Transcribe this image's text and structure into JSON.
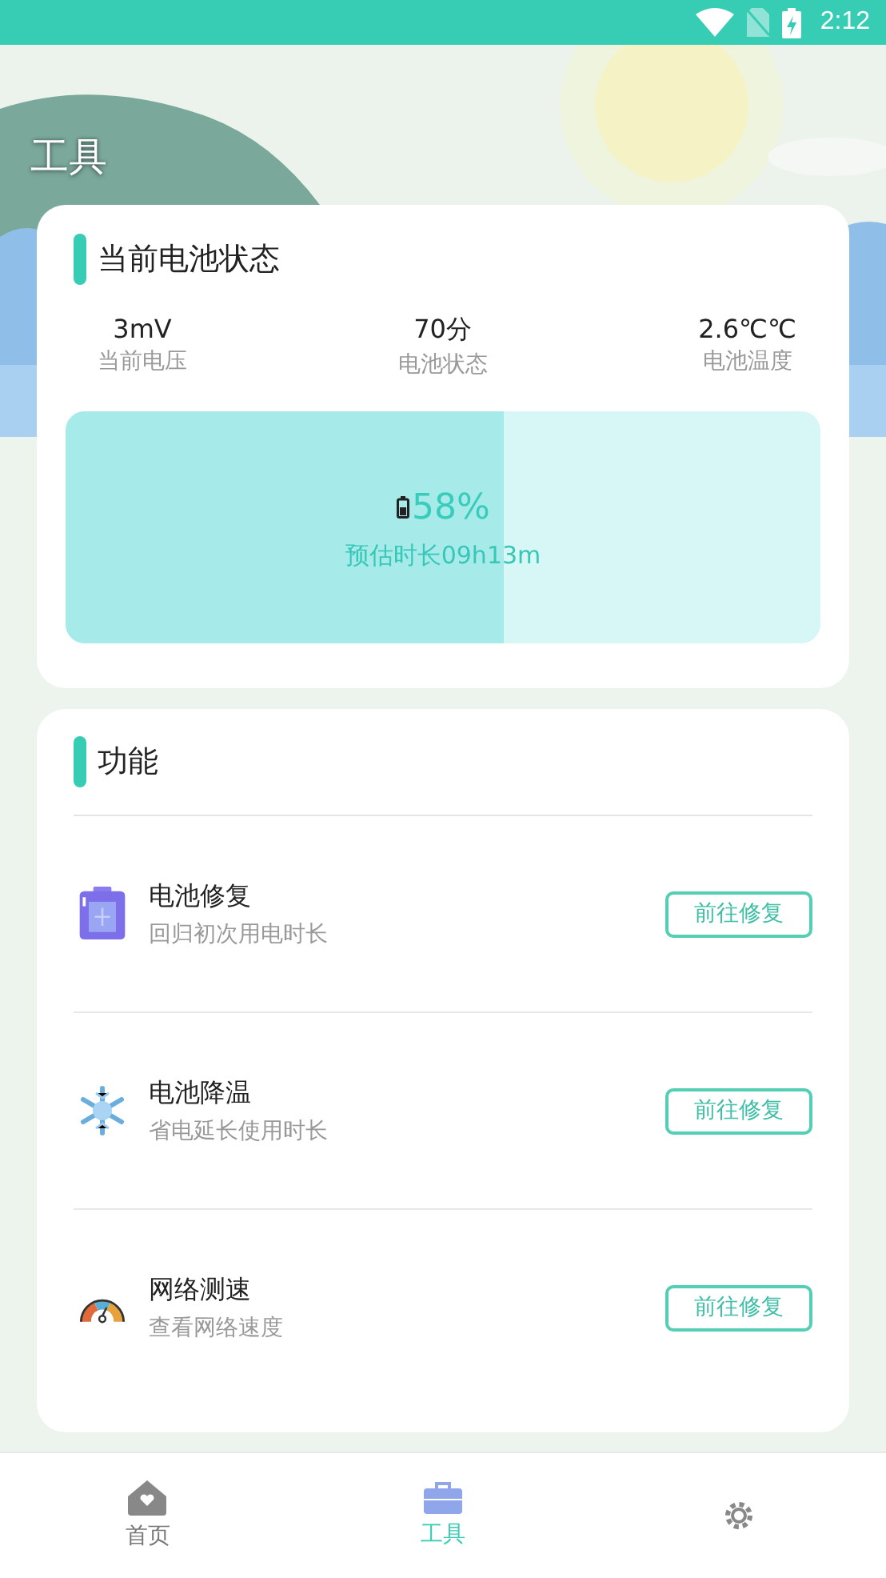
{
  "status_bar": {
    "time": "2:12"
  },
  "title": "工具",
  "battery_card": {
    "title": "当前电池状态",
    "stats": [
      {
        "value": "3mV",
        "label": "当前电压"
      },
      {
        "value": "70分",
        "label": "电池状态"
      },
      {
        "value": "2.6℃℃",
        "label": "电池温度"
      }
    ],
    "meter": {
      "level": 0.58,
      "percent": "58%",
      "estimate": "预估时长09h13m"
    }
  },
  "features_card": {
    "title": "功能",
    "items": [
      {
        "kind": "battery",
        "name": "电池修复",
        "desc": "回归初次用电时长",
        "button": "前往修复"
      },
      {
        "kind": "snowflake",
        "name": "电池降温",
        "desc": "省电延长使用时长",
        "button": "前往修复"
      },
      {
        "kind": "gauge",
        "name": "网络测速",
        "desc": "查看网络速度",
        "button": "前往修复"
      }
    ]
  },
  "tabs": [
    {
      "kind": "home",
      "label": "首页",
      "selected": false
    },
    {
      "kind": "toolbox",
      "label": "工具",
      "selected": true
    },
    {
      "kind": "gear",
      "selected": false
    }
  ]
}
